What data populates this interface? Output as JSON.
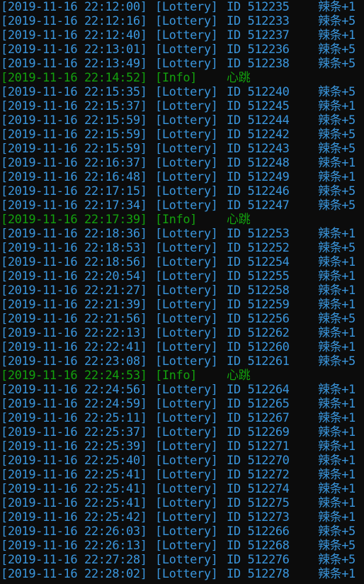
{
  "console": {
    "colors": {
      "background": "#0c0c0c",
      "lottery_text": "#3a96dd",
      "info_text": "#13a10e"
    },
    "lines": [
      {
        "type": "lottery",
        "ts": "[2019-11-16 22:12:00]",
        "tag": "[Lottery]",
        "id": "ID 512235",
        "reward": "辣条+1"
      },
      {
        "type": "lottery",
        "ts": "[2019-11-16 22:12:16]",
        "tag": "[Lottery]",
        "id": "ID 512233",
        "reward": "辣条+5"
      },
      {
        "type": "lottery",
        "ts": "[2019-11-16 22:12:40]",
        "tag": "[Lottery]",
        "id": "ID 512237",
        "reward": "辣条+1"
      },
      {
        "type": "lottery",
        "ts": "[2019-11-16 22:13:01]",
        "tag": "[Lottery]",
        "id": "ID 512236",
        "reward": "辣条+5"
      },
      {
        "type": "lottery",
        "ts": "[2019-11-16 22:13:49]",
        "tag": "[Lottery]",
        "id": "ID 512238",
        "reward": "辣条+5"
      },
      {
        "type": "info",
        "ts": "[2019-11-16 22:14:52]",
        "tag": "[Info]",
        "id": "",
        "reward": "心跳"
      },
      {
        "type": "lottery",
        "ts": "[2019-11-16 22:15:35]",
        "tag": "[Lottery]",
        "id": "ID 512240",
        "reward": "辣条+5"
      },
      {
        "type": "lottery",
        "ts": "[2019-11-16 22:15:37]",
        "tag": "[Lottery]",
        "id": "ID 512245",
        "reward": "辣条+1"
      },
      {
        "type": "lottery",
        "ts": "[2019-11-16 22:15:59]",
        "tag": "[Lottery]",
        "id": "ID 512244",
        "reward": "辣条+5"
      },
      {
        "type": "lottery",
        "ts": "[2019-11-16 22:15:59]",
        "tag": "[Lottery]",
        "id": "ID 512242",
        "reward": "辣条+5"
      },
      {
        "type": "lottery",
        "ts": "[2019-11-16 22:15:59]",
        "tag": "[Lottery]",
        "id": "ID 512243",
        "reward": "辣条+5"
      },
      {
        "type": "lottery",
        "ts": "[2019-11-16 22:16:37]",
        "tag": "[Lottery]",
        "id": "ID 512248",
        "reward": "辣条+1"
      },
      {
        "type": "lottery",
        "ts": "[2019-11-16 22:16:48]",
        "tag": "[Lottery]",
        "id": "ID 512249",
        "reward": "辣条+1"
      },
      {
        "type": "lottery",
        "ts": "[2019-11-16 22:17:15]",
        "tag": "[Lottery]",
        "id": "ID 512246",
        "reward": "辣条+5"
      },
      {
        "type": "lottery",
        "ts": "[2019-11-16 22:17:34]",
        "tag": "[Lottery]",
        "id": "ID 512247",
        "reward": "辣条+5"
      },
      {
        "type": "info",
        "ts": "[2019-11-16 22:17:39]",
        "tag": "[Info]",
        "id": "",
        "reward": "心跳"
      },
      {
        "type": "lottery",
        "ts": "[2019-11-16 22:18:36]",
        "tag": "[Lottery]",
        "id": "ID 512253",
        "reward": "辣条+1"
      },
      {
        "type": "lottery",
        "ts": "[2019-11-16 22:18:53]",
        "tag": "[Lottery]",
        "id": "ID 512252",
        "reward": "辣条+5"
      },
      {
        "type": "lottery",
        "ts": "[2019-11-16 22:18:56]",
        "tag": "[Lottery]",
        "id": "ID 512254",
        "reward": "辣条+1"
      },
      {
        "type": "lottery",
        "ts": "[2019-11-16 22:20:54]",
        "tag": "[Lottery]",
        "id": "ID 512255",
        "reward": "辣条+1"
      },
      {
        "type": "lottery",
        "ts": "[2019-11-16 22:21:27]",
        "tag": "[Lottery]",
        "id": "ID 512258",
        "reward": "辣条+1"
      },
      {
        "type": "lottery",
        "ts": "[2019-11-16 22:21:39]",
        "tag": "[Lottery]",
        "id": "ID 512259",
        "reward": "辣条+1"
      },
      {
        "type": "lottery",
        "ts": "[2019-11-16 22:21:56]",
        "tag": "[Lottery]",
        "id": "ID 512256",
        "reward": "辣条+5"
      },
      {
        "type": "lottery",
        "ts": "[2019-11-16 22:22:13]",
        "tag": "[Lottery]",
        "id": "ID 512262",
        "reward": "辣条+1"
      },
      {
        "type": "lottery",
        "ts": "[2019-11-16 22:22:41]",
        "tag": "[Lottery]",
        "id": "ID 512260",
        "reward": "辣条+1"
      },
      {
        "type": "lottery",
        "ts": "[2019-11-16 22:23:08]",
        "tag": "[Lottery]",
        "id": "ID 512261",
        "reward": "辣条+5"
      },
      {
        "type": "info",
        "ts": "[2019-11-16 22:24:53]",
        "tag": "[Info]",
        "id": "",
        "reward": "心跳"
      },
      {
        "type": "lottery",
        "ts": "[2019-11-16 22:24:56]",
        "tag": "[Lottery]",
        "id": "ID 512264",
        "reward": "辣条+1"
      },
      {
        "type": "lottery",
        "ts": "[2019-11-16 22:24:59]",
        "tag": "[Lottery]",
        "id": "ID 512265",
        "reward": "辣条+1"
      },
      {
        "type": "lottery",
        "ts": "[2019-11-16 22:25:11]",
        "tag": "[Lottery]",
        "id": "ID 512267",
        "reward": "辣条+1"
      },
      {
        "type": "lottery",
        "ts": "[2019-11-16 22:25:37]",
        "tag": "[Lottery]",
        "id": "ID 512269",
        "reward": "辣条+1"
      },
      {
        "type": "lottery",
        "ts": "[2019-11-16 22:25:39]",
        "tag": "[Lottery]",
        "id": "ID 512271",
        "reward": "辣条+1"
      },
      {
        "type": "lottery",
        "ts": "[2019-11-16 22:25:40]",
        "tag": "[Lottery]",
        "id": "ID 512270",
        "reward": "辣条+1"
      },
      {
        "type": "lottery",
        "ts": "[2019-11-16 22:25:41]",
        "tag": "[Lottery]",
        "id": "ID 512272",
        "reward": "辣条+1"
      },
      {
        "type": "lottery",
        "ts": "[2019-11-16 22:25:41]",
        "tag": "[Lottery]",
        "id": "ID 512274",
        "reward": "辣条+1"
      },
      {
        "type": "lottery",
        "ts": "[2019-11-16 22:25:41]",
        "tag": "[Lottery]",
        "id": "ID 512275",
        "reward": "辣条+1"
      },
      {
        "type": "lottery",
        "ts": "[2019-11-16 22:25:42]",
        "tag": "[Lottery]",
        "id": "ID 512273",
        "reward": "辣条+1"
      },
      {
        "type": "lottery",
        "ts": "[2019-11-16 22:26:03]",
        "tag": "[Lottery]",
        "id": "ID 512266",
        "reward": "辣条+5"
      },
      {
        "type": "lottery",
        "ts": "[2019-11-16 22:26:13]",
        "tag": "[Lottery]",
        "id": "ID 512268",
        "reward": "辣条+5"
      },
      {
        "type": "lottery",
        "ts": "[2019-11-16 22:27:28]",
        "tag": "[Lottery]",
        "id": "ID 512276",
        "reward": "辣条+5"
      },
      {
        "type": "lottery",
        "ts": "[2019-11-16 22:28:02]",
        "tag": "[Lottery]",
        "id": "ID 512278",
        "reward": "辣条+1"
      }
    ]
  }
}
